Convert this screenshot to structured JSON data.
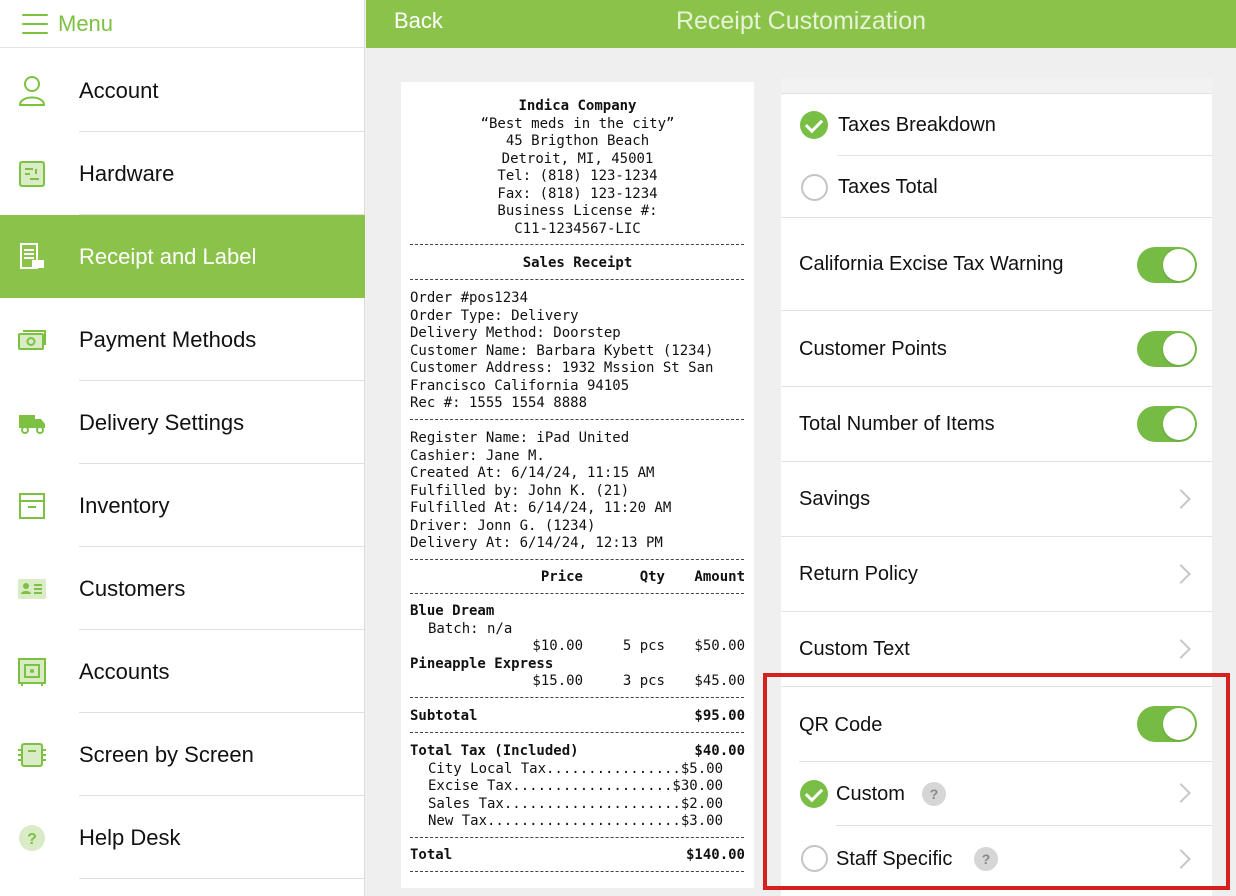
{
  "sidebar": {
    "menu_label": "Menu",
    "items": [
      {
        "label": "Account",
        "icon": "user-icon"
      },
      {
        "label": "Hardware",
        "icon": "hardware-icon"
      },
      {
        "label": "Receipt and Label",
        "icon": "receipt-icon",
        "active": true
      },
      {
        "label": "Payment Methods",
        "icon": "cash-icon"
      },
      {
        "label": "Delivery Settings",
        "icon": "truck-icon"
      },
      {
        "label": "Inventory",
        "icon": "box-icon"
      },
      {
        "label": "Customers",
        "icon": "contact-card-icon"
      },
      {
        "label": "Accounts",
        "icon": "safe-icon"
      },
      {
        "label": "Screen by Screen",
        "icon": "screens-icon"
      },
      {
        "label": "Help Desk",
        "icon": "help-icon"
      }
    ]
  },
  "topbar": {
    "back_label": "Back",
    "title": "Receipt Customization"
  },
  "receipt": {
    "company": "Indica Company",
    "tagline": "“Best meds in the city”",
    "address1": "45 Brigthon Beach",
    "address2": "Detroit, MI, 45001",
    "tel": "Tel: (818) 123-1234",
    "fax": "Fax: (818) 123-1234",
    "license_label": "Business License #:",
    "license": "C11-1234567-LIC",
    "heading": "Sales Receipt",
    "order_lines": [
      "Order #pos1234",
      "Order Type: Delivery",
      "Delivery Method: Doorstep",
      "Customer Name: Barbara Kybett (1234)",
      "Customer Address: 1932 Mssion St San",
      "Francisco California 94105",
      "Rec #: 1555 1554 8888"
    ],
    "register_lines": [
      "Register Name: iPad United",
      "Cashier: Jane M.",
      "Created At: 6/14/24, 11:15 AM",
      "Fulfilled by: John K. (21)",
      "Fulfilled At: 6/14/24, 11:20 AM",
      "Driver: Jonn G. (1234)",
      "Delivery At: 6/14/24, 12:13 PM"
    ],
    "columns": {
      "price": "Price",
      "qty": "Qty",
      "amount": "Amount"
    },
    "items": [
      {
        "name": "Blue Dream",
        "batch": "Batch: n/a",
        "price": "$10.00",
        "qty": "5 pcs",
        "amount": "$50.00"
      },
      {
        "name": "Pineapple Express",
        "price": "$15.00",
        "qty": "3 pcs",
        "amount": "$45.00"
      }
    ],
    "subtotal_label": "Subtotal",
    "subtotal": "$95.00",
    "tax_label": "Total Tax (Included)",
    "tax": "$40.00",
    "tax_lines": [
      "City Local Tax................$5.00",
      "Excise Tax...................$30.00",
      "Sales Tax.....................$2.00",
      "New Tax.......................$3.00"
    ],
    "total_label": "Total",
    "total": "$140.00"
  },
  "settings": {
    "taxes_breakdown": "Taxes Breakdown",
    "taxes_total": "Taxes Total",
    "ca_excise_warning": "California Excise Tax Warning",
    "customer_points": "Customer Points",
    "total_items": "Total Number of Items",
    "savings": "Savings",
    "return_policy": "Return Policy",
    "custom_text": "Custom Text",
    "qr_code": "QR Code",
    "custom": "Custom",
    "staff_specific": "Staff Specific",
    "help_glyph": "?"
  },
  "colors": {
    "accent": "#8bc34a",
    "toggle_on": "#76bb44",
    "highlight": "#d62020"
  }
}
